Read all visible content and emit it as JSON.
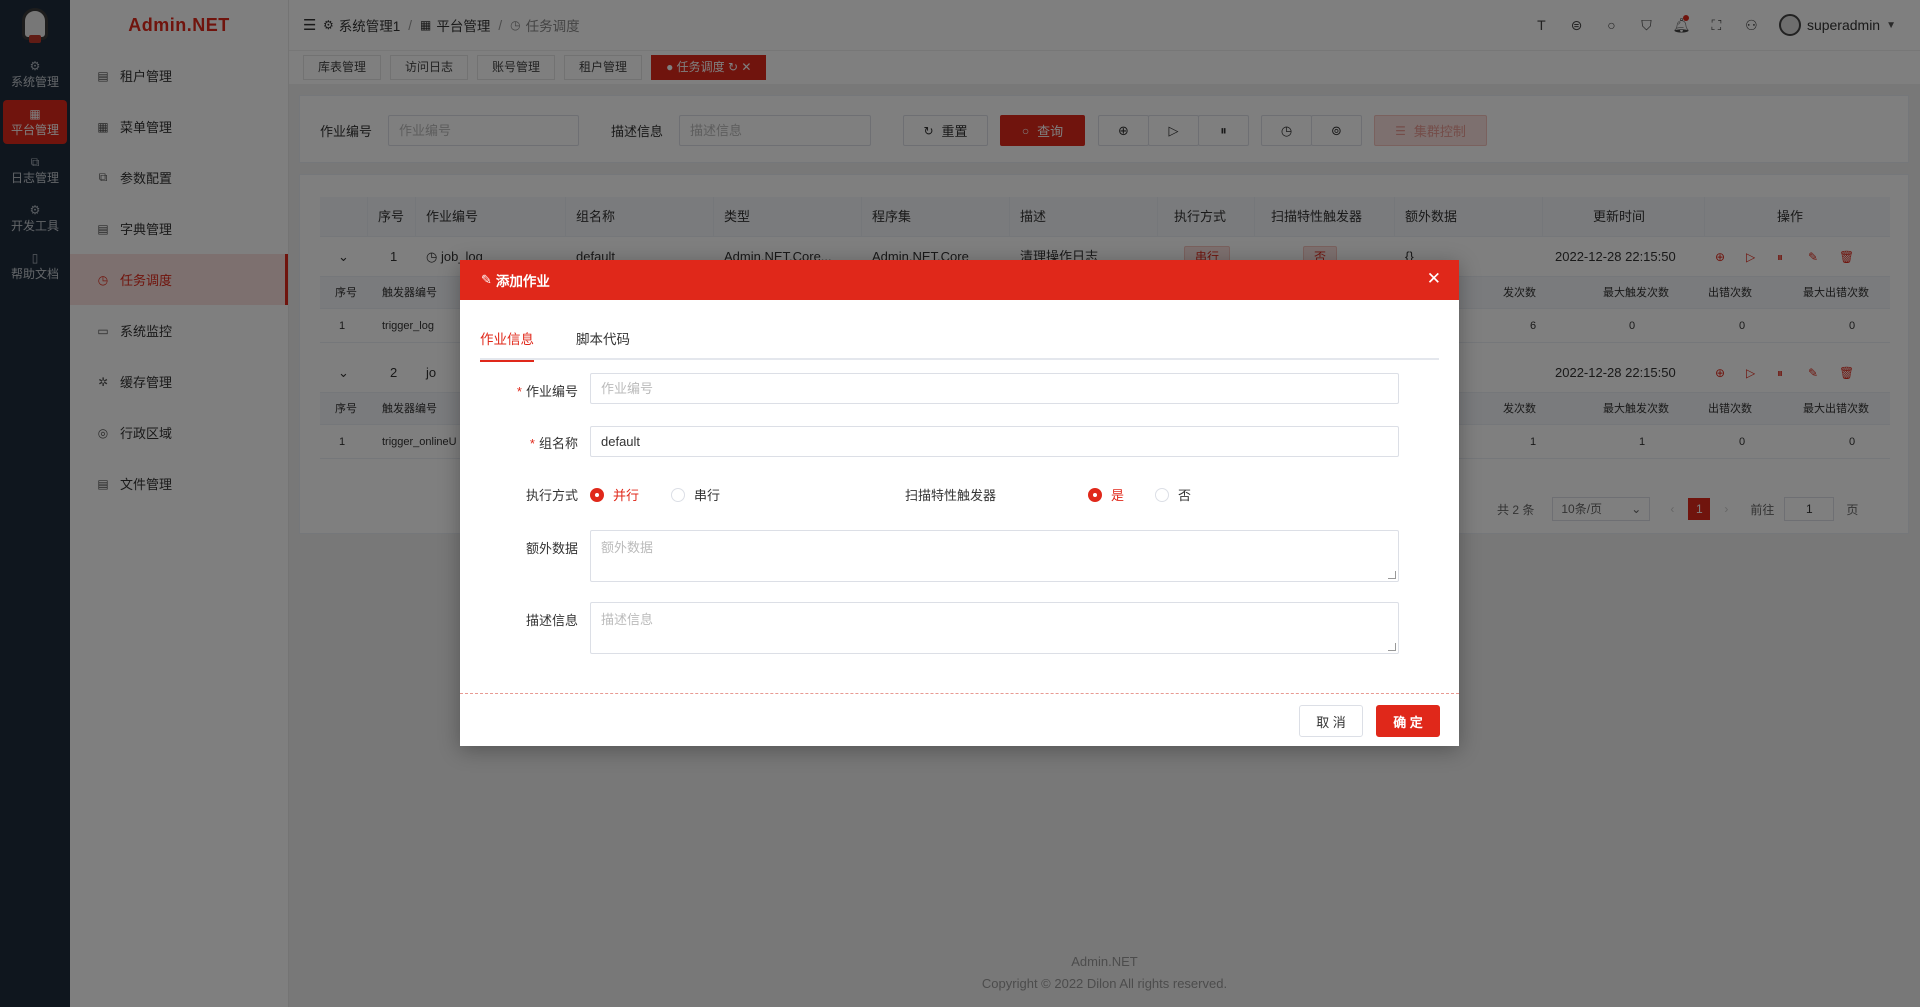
{
  "rail": {
    "items": [
      {
        "label": "系统管理",
        "icon": "⚙"
      },
      {
        "label": "平台管理",
        "icon": "▦"
      },
      {
        "label": "日志管理",
        "icon": "⧉"
      },
      {
        "label": "开发工具",
        "icon": "⚙"
      },
      {
        "label": "帮助文档",
        "icon": "▯"
      }
    ]
  },
  "brand": "Admin.NET",
  "menu": {
    "items": [
      {
        "label": "租户管理",
        "icon": "▤"
      },
      {
        "label": "菜单管理",
        "icon": "▦"
      },
      {
        "label": "参数配置",
        "icon": "⧉"
      },
      {
        "label": "字典管理",
        "icon": "▤"
      },
      {
        "label": "任务调度",
        "icon": "◷"
      },
      {
        "label": "系统监控",
        "icon": "▭"
      },
      {
        "label": "缓存管理",
        "icon": "✲"
      },
      {
        "label": "行政区域",
        "icon": "◎"
      },
      {
        "label": "文件管理",
        "icon": "▤"
      }
    ]
  },
  "header": {
    "crumb1": "系统管理1",
    "crumb2": "平台管理",
    "crumb3": "任务调度",
    "username": "superadmin"
  },
  "tabs": [
    "库表管理",
    "访问日志",
    "账号管理",
    "租户管理",
    "任务调度"
  ],
  "search": {
    "job_label": "作业编号",
    "job_placeholder": "作业编号",
    "desc_label": "描述信息",
    "desc_placeholder": "描述信息",
    "reset": "重置",
    "query": "查询",
    "cluster": "集群控制"
  },
  "table": {
    "headers": [
      "序号",
      "作业编号",
      "组名称",
      "类型",
      "程序集",
      "描述",
      "执行方式",
      "扫描特性触发器",
      "额外数据",
      "更新时间",
      "操作"
    ],
    "row1": {
      "index": "1",
      "job_id": "job_log",
      "group": "default",
      "type": "Admin.NET.Core...",
      "assembly": "Admin.NET.Core",
      "desc": "清理操作日志",
      "mode": "串行",
      "scan": "否",
      "extra": "{}",
      "updated": "2022-12-28 22:15:50"
    },
    "sub_headers": [
      "序号",
      "触发器编号",
      "触发次数",
      "最大触发次数",
      "出错次数",
      "最大出错次数"
    ],
    "sub1": {
      "index": "1",
      "trigger": "trigger_log",
      "fire": "6",
      "max_fire": "0",
      "err": "0",
      "max_err": "0"
    },
    "row2": {
      "index": "2",
      "job_id": "jo",
      "updated": "2022-12-28 22:15:50"
    },
    "sub2": {
      "index": "1",
      "trigger": "trigger_onlineU",
      "fire": "1",
      "max_fire": "1",
      "err": "0",
      "max_err": "0"
    },
    "sub_fire_short": "发次数"
  },
  "pager": {
    "total": "共 2 条",
    "size": "10条/页",
    "page": "1",
    "goto": "前往",
    "goto_value": "1",
    "page_suffix": "页"
  },
  "footer": {
    "line1": "Admin.NET",
    "line2": "Copyright © 2022 Dilon All rights reserved."
  },
  "dialog": {
    "title": "添加作业",
    "tab_info": "作业信息",
    "tab_script": "脚本代码",
    "job_label": "作业编号",
    "job_placeholder": "作业编号",
    "group_label": "组名称",
    "group_value": "default",
    "mode_label": "执行方式",
    "mode_parallel": "并行",
    "mode_serial": "串行",
    "scan_label": "扫描特性触发器",
    "scan_yes": "是",
    "scan_no": "否",
    "extra_label": "额外数据",
    "extra_placeholder": "额外数据",
    "desc_label": "描述信息",
    "desc_placeholder": "描述信息",
    "cancel": "取 消",
    "confirm": "确 定"
  },
  "colors": {
    "accent": "#e0281a",
    "rail_bg": "#1f2d3d"
  }
}
